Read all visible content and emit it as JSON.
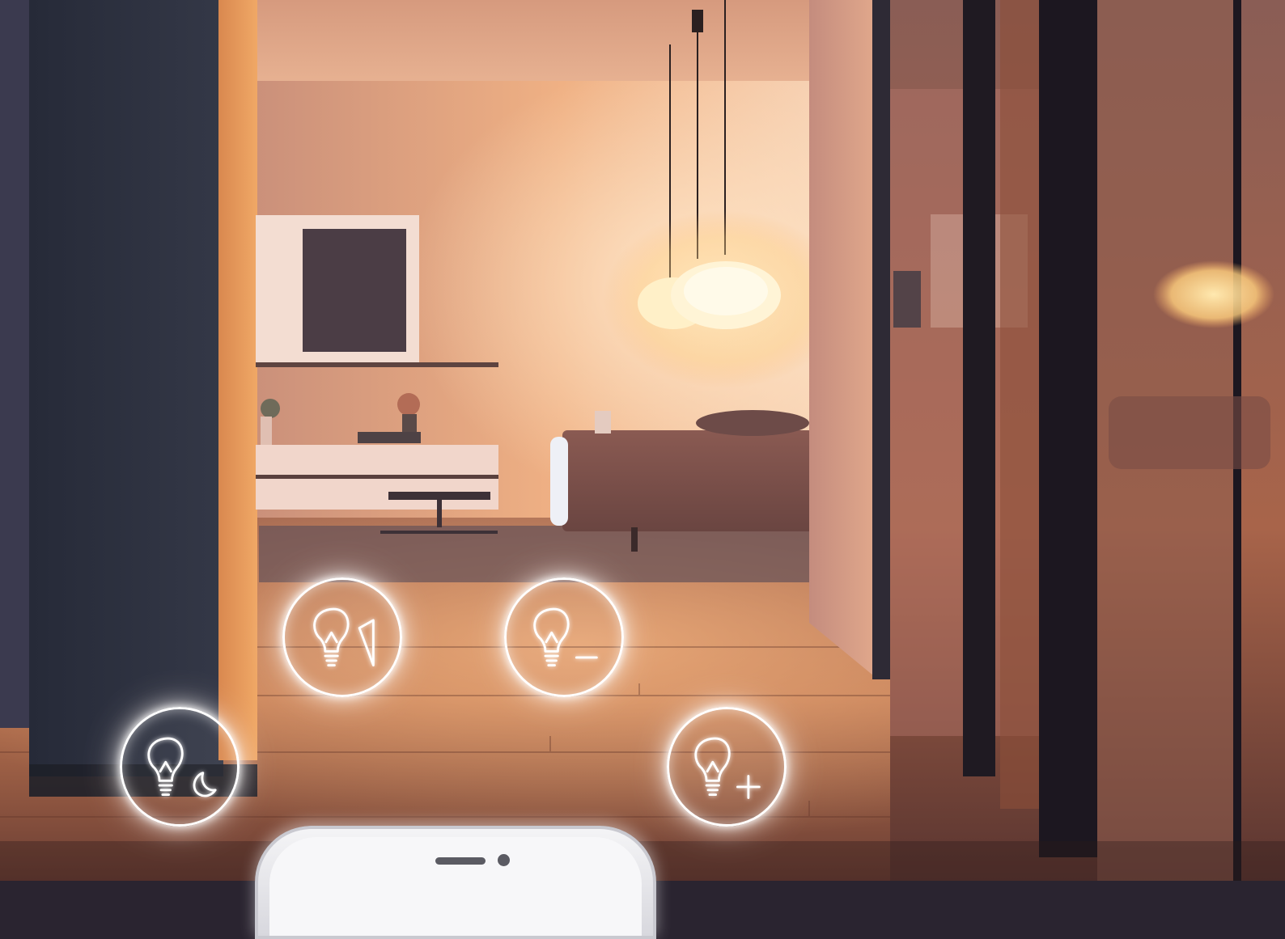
{
  "scene": {
    "description_colors": {
      "warm_light": "#ffb066",
      "lamp_glow": "#fff2d0",
      "pillar_dark": "#2c3040",
      "floor_wood": "#b56a45"
    }
  },
  "controls": [
    {
      "id": "btn-shape-dim",
      "icon": "bulb-dimmer-icon"
    },
    {
      "id": "btn-minus",
      "icon": "bulb-minus-icon"
    },
    {
      "id": "btn-night",
      "icon": "bulb-night-mode-icon"
    },
    {
      "id": "btn-plus",
      "icon": "bulb-plus-icon"
    }
  ],
  "phone": {
    "icon": "smartphone-top"
  }
}
